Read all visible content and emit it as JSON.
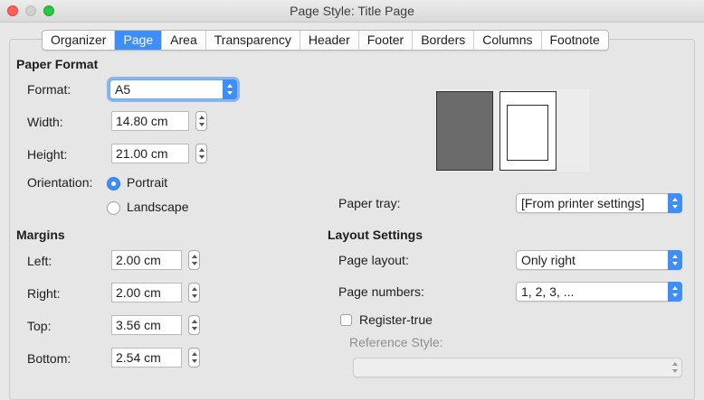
{
  "window": {
    "title": "Page Style: Title Page"
  },
  "tabs": [
    "Organizer",
    "Page",
    "Area",
    "Transparency",
    "Header",
    "Footer",
    "Borders",
    "Columns",
    "Footnote"
  ],
  "active_tab": "Page",
  "paper_format": {
    "heading": "Paper Format",
    "format_label": "Format:",
    "format_value": "A5",
    "width_label": "Width:",
    "width_value": "14.80 cm",
    "height_label": "Height:",
    "height_value": "21.00 cm",
    "orientation_label": "Orientation:",
    "portrait_label": "Portrait",
    "landscape_label": "Landscape",
    "orientation_selected": "Portrait"
  },
  "margins": {
    "heading": "Margins",
    "left_label": "Left:",
    "left_value": "2.00 cm",
    "right_label": "Right:",
    "right_value": "2.00 cm",
    "top_label": "Top:",
    "top_value": "3.56 cm",
    "bottom_label": "Bottom:",
    "bottom_value": "2.54 cm"
  },
  "paper_tray": {
    "label": "Paper tray:",
    "value": "[From printer settings]"
  },
  "layout_settings": {
    "heading": "Layout Settings",
    "page_layout_label": "Page layout:",
    "page_layout_value": "Only right",
    "page_numbers_label": "Page numbers:",
    "page_numbers_value": "1, 2, 3, ...",
    "register_true_label": "Register-true",
    "register_true_checked": false,
    "reference_style_label": "Reference Style:",
    "reference_style_value": ""
  },
  "colors": {
    "accent": "#3d8ef6",
    "preview_left_page": "#6b6b6b"
  }
}
